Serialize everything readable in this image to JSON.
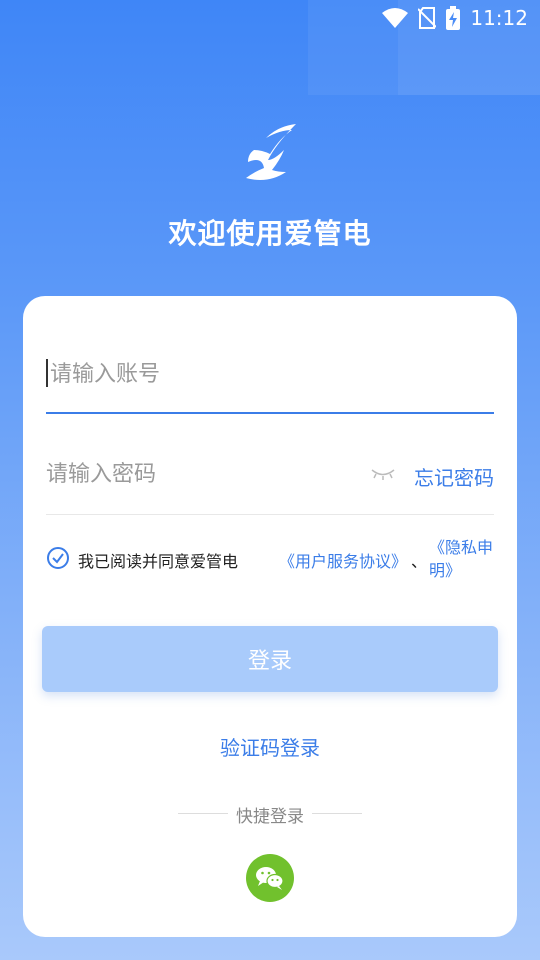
{
  "status_bar": {
    "time": "11:12"
  },
  "colors": {
    "primary": "#3b7de8",
    "button_disabled": "#a9cbfb",
    "wechat": "#71c12d"
  },
  "header": {
    "title": "欢迎使用爱管电",
    "logo_icon": "app-logo-icon"
  },
  "login_form": {
    "account_placeholder": "请输入账号",
    "password_placeholder": "请输入密码",
    "forgot_password": "忘记密码",
    "agreement_prefix": "我已阅读并同意爱管电",
    "user_agreement_link": "《用户服务协议》",
    "separator": "、",
    "privacy_link": "《隐私申明》",
    "agreement_checked": true,
    "login_button": "登录",
    "sms_login": "验证码登录",
    "quick_login_label": "快捷登录",
    "quick_login_icon": "wechat-icon"
  }
}
